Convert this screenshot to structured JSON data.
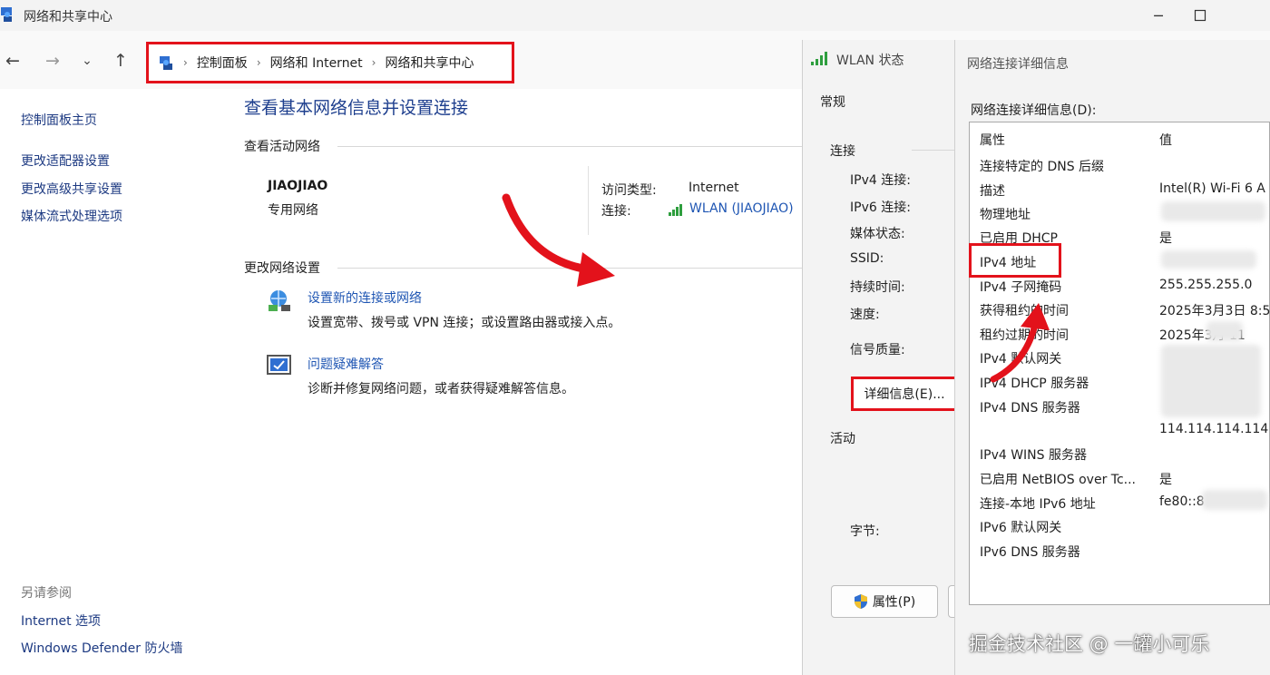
{
  "main": {
    "title": "网络和共享中心",
    "breadcrumb": [
      "控制面板",
      "网络和 Internet",
      "网络和共享中心"
    ],
    "page_title": "查看基本网络信息并设置连接",
    "sidebar": {
      "items": [
        "控制面板主页",
        "更改适配器设置",
        "更改高级共享设置",
        "媒体流式处理选项"
      ],
      "see_also_heading": "另请参阅",
      "see_also": [
        "Internet 选项",
        "Windows Defender 防火墙"
      ]
    },
    "active_network": {
      "heading": "查看活动网络",
      "name": "JIAOJIAO",
      "type": "专用网络",
      "access_type_label": "访问类型:",
      "access_type_value": "Internet",
      "connection_label": "连接:",
      "connection_value": "WLAN (JIAOJIAO)"
    },
    "change_settings": {
      "heading": "更改网络设置",
      "items": [
        {
          "title": "设置新的连接或网络",
          "desc": "设置宽带、拨号或 VPN 连接；或设置路由器或接入点。"
        },
        {
          "title": "问题疑难解答",
          "desc": "诊断并修复网络问题，或者获得疑难解答信息。"
        }
      ]
    }
  },
  "wlan_dialog": {
    "title": "WLAN 状态",
    "tab": "常规",
    "connection_heading": "连接",
    "labels": [
      "IPv4 连接:",
      "IPv6 连接:",
      "媒体状态:",
      "SSID:",
      "持续时间:",
      "速度:"
    ],
    "signal_label": "信号质量:",
    "details_button": "详细信息(E)...",
    "activity_heading": "活动",
    "bytes_label": "字节:",
    "properties_button": "属性(P)"
  },
  "details_dialog": {
    "title": "网络连接详细信息",
    "list_label": "网络连接详细信息(D):",
    "col_property": "属性",
    "col_value": "值",
    "rows": [
      {
        "name": "连接特定的 DNS 后缀",
        "value": ""
      },
      {
        "name": "描述",
        "value": "Intel(R) Wi-Fi 6 A"
      },
      {
        "name": "物理地址",
        "value": ""
      },
      {
        "name": "已启用 DHCP",
        "value": "是"
      },
      {
        "name": "IPv4 地址",
        "value": ""
      },
      {
        "name": "IPv4 子网掩码",
        "value": "255.255.255.0"
      },
      {
        "name": "获得租约的时间",
        "value": "2025年3月3日 8:5"
      },
      {
        "name": "租约过期的时间",
        "value": "2025年3月   11"
      },
      {
        "name": "IPv4 默认网关",
        "value": ""
      },
      {
        "name": "IPv4 DHCP 服务器",
        "value": ""
      },
      {
        "name": "IPv4 DNS 服务器",
        "value": ""
      },
      {
        "name": "",
        "value": "114.114.114.114"
      },
      {
        "name": "IPv4 WINS 服务器",
        "value": ""
      },
      {
        "name": "已启用 NetBIOS over Tc...",
        "value": "是"
      },
      {
        "name": "连接-本地 IPv6 地址",
        "value": "fe80::8"
      },
      {
        "name": "IPv6 默认网关",
        "value": ""
      },
      {
        "name": "IPv6 DNS 服务器",
        "value": ""
      }
    ]
  },
  "watermark": "掘金技术社区 @ 一罐小可乐",
  "colors": {
    "highlight_red": "#e3121b",
    "link_blue": "#1f56b3",
    "signal_green": "#2e9e3e"
  },
  "icons": [
    "network-center-icon",
    "back-arrow-icon",
    "forward-arrow-icon",
    "dropdown-chevron-icon",
    "up-arrow-icon",
    "wifi-signal-icon",
    "new-connection-icon",
    "troubleshoot-icon",
    "shield-icon",
    "annotation-arrow-icon"
  ]
}
